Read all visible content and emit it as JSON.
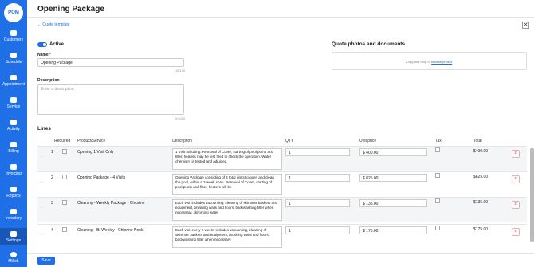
{
  "app": {
    "logo": "POM"
  },
  "sidebar": {
    "items": [
      {
        "label": "Customers",
        "icon": "customers-icon"
      },
      {
        "label": "Schedule",
        "icon": "calendar-icon"
      },
      {
        "label": "Appointment",
        "icon": "appointment-icon"
      },
      {
        "label": "Service",
        "icon": "wrench-icon"
      },
      {
        "label": "Activity",
        "icon": "activity-icon"
      },
      {
        "label": "Billing",
        "icon": "billing-icon"
      },
      {
        "label": "Invoicing",
        "icon": "invoice-icon"
      },
      {
        "label": "Reports",
        "icon": "reports-icon"
      },
      {
        "label": "Inventory",
        "icon": "inventory-icon"
      },
      {
        "label": "Settings",
        "icon": "gear-icon"
      },
      {
        "label": "MikeL",
        "icon": "user-icon"
      }
    ]
  },
  "page": {
    "title": "Opening Package",
    "back": "← Quote template",
    "close": "✕"
  },
  "active_label": "Active",
  "name": {
    "label": "Name",
    "required": "*",
    "value": "Opening Package",
    "counter": "15/100"
  },
  "description": {
    "label": "Description",
    "placeholder": "Enter a description",
    "counter": "0/4000"
  },
  "photos": {
    "title": "Quote photos and documents",
    "drop_text": "Drag and drop or ",
    "browse": "browse photos"
  },
  "lines": {
    "title": "Lines",
    "headers": {
      "required": "Required",
      "product": "Product/Service",
      "description": "Description",
      "qty": "QTY",
      "unit_price": "Unit price",
      "tax": "Tax",
      "total": "Total"
    },
    "rows": [
      {
        "num": "1",
        "product": "Opening 1 Visit Only",
        "description": "1 Visit Including: Removal of Cover, starting of pool pump and filter, heaters may be test fired to check the operation. Water chemistry is tested and adjusted,",
        "qty": "1",
        "price": "400.00",
        "total": "$400.00"
      },
      {
        "num": "2",
        "product": "Opening Package - 4 Visits",
        "description": "Opening Package consisting of 4 total visits to open and clean the pool, within a 2-week span. Removal of Cover, starting of pool pump and filter, heaters will be",
        "qty": "1",
        "price": "825.00",
        "total": "$825.00"
      },
      {
        "num": "3",
        "product": "Cleaning - Weekly Package - Chlorine",
        "description": "Each visit includes vacuuming, cleaning of skimmer baskets and equipment, brushing walls and floors, backwashing filter when necessary, skimming water",
        "qty": "1",
        "price": "135.00",
        "total": "$135.00"
      },
      {
        "num": "4",
        "product": "Cleaning - Bi-Weekly - Chlorine Pools",
        "description": "Each visit every 2 weeks includes vacuuming, cleaning of skimmer baskets and equipment, brushing walls and floors, backwashing filter when necessary,",
        "qty": "1",
        "price": "175.00",
        "total": "$175.00"
      }
    ]
  },
  "currency": "$",
  "footer": {
    "save": "Save"
  }
}
